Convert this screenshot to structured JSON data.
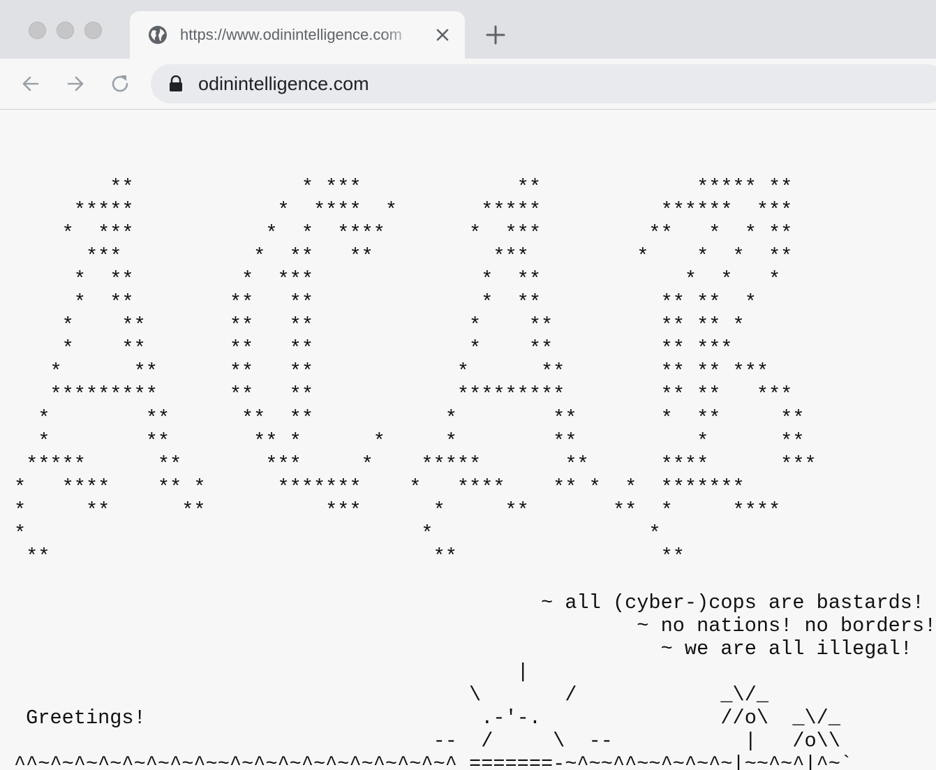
{
  "browser": {
    "tab_title": "https://www.odinintelligence.com",
    "url": "odinintelligence.com"
  },
  "page": {
    "ascii_art": "\n        **              * ***             **             ***** **\n     *****            *  ****  *       *****          ******  ***\n    *  ***           *  *  ****       *  ***         **   *  * **\n      ***           *  **   **          ***         *    *  *  **\n     *  **         *  ***              *  **            *  *   *\n     *  **        **   **              *  **          ** **  *\n    *    **       **   **             *    **         ** ** *\n    *    **       **   **             *    **         ** ***\n   *      **      **   **            *      **        ** ** ***\n   *********      **   **            *********        ** **   ***\n  *        **      **  **           *        **       *  **     **\n  *        **       ** *      *     *        **          *      **\n *****      **       ***     *    *****       **      ****      ***\n*   ****    ** *      *******    *   ****    ** *  *  *******\n*     **      **          ***      *     **       **  *     ****\n*                                 *                  *\n **                                **                 **\n\n                                            ~ all (cyber-)cops are bastards!\n                                                    ~ no nations! no borders!\n                                                      ~ we are all illegal!\n                                          |\n                                      \\       /            _\\/_\n Greetings!                            .-'-.               //o\\  _\\/_\n                                   --  /     \\  --           |   /o\\\\\n^^~^~^~^~^~^~^~^~~^~^~^~^~^~^~^~^~^~^_=======-~^~~^^~~^~^~^~|~~^~^|^~`"
  }
}
